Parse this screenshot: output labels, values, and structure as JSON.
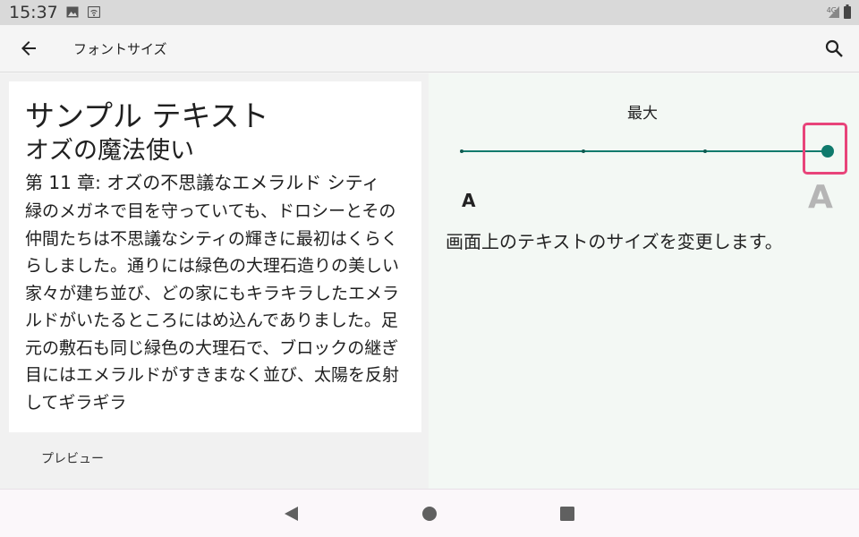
{
  "status_bar": {
    "time": "15:37",
    "icons": [
      "image-icon",
      "wifi-cast-icon"
    ],
    "network": "4G",
    "right_icons": [
      "cell-signal-icon",
      "battery-icon"
    ]
  },
  "app_bar": {
    "title": "フォントサイズ",
    "back_icon": "arrow-left-icon",
    "search_icon": "search-icon"
  },
  "preview": {
    "heading1": "サンプル テキスト",
    "heading2": "オズの魔法使い",
    "heading3": "第 11 章: オズの不思議なエメラルド シティ",
    "body": "緑のメガネで目を守っていても、ドロシーとその仲間たちは不思議なシティの輝きに最初はくらくらしました。通りには緑色の大理石造りの美しい家々が建ち並び、どの家にもキラキラしたエメラルドがいたるところにはめ込んでありました。足元の敷石も同じ緑色の大理石で、ブロックの継ぎ目にはエメラルドがすきまなく並び、太陽を反射してギラギラ",
    "label": "プレビュー"
  },
  "font_size": {
    "level_label": "最大",
    "small_glyph": "A",
    "large_glyph": "A",
    "description": "画面上のテキストのサイズを変更します。",
    "slider": {
      "steps": 4,
      "selected_index": 3
    },
    "accent_color": "#0f7a6c",
    "highlight_color": "#e8447a"
  },
  "nav_bar": {
    "icons": [
      "back-triangle-icon",
      "home-circle-icon",
      "recents-square-icon"
    ]
  }
}
